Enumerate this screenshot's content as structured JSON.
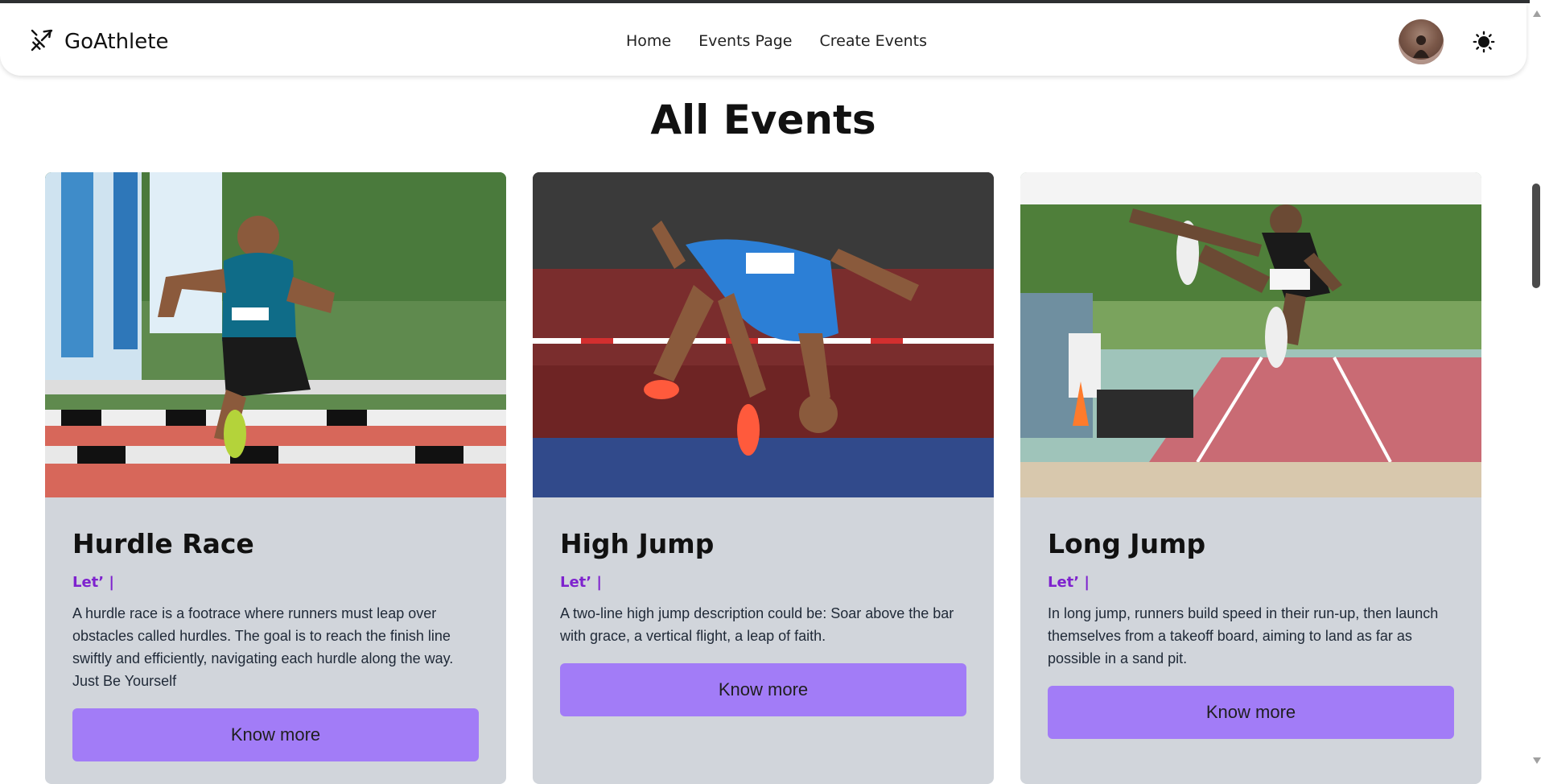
{
  "brand": {
    "name": "GoAthlete",
    "logo_icon": "plane-arrow-icon"
  },
  "nav": {
    "items": [
      {
        "label": "Home"
      },
      {
        "label": "Events Page"
      },
      {
        "label": "Create Events"
      }
    ]
  },
  "header": {
    "avatar_icon": "user-avatar",
    "theme_icon": "sun-icon"
  },
  "main": {
    "title": "All Events"
  },
  "events": [
    {
      "title": "Hurdle Race",
      "tag": "Let’ |",
      "description": "A hurdle race is a footrace where runners must leap over obstacles called hurdles. The goal is to reach the finish line swiftly and efficiently, navigating each hurdle along the way. Just Be Yourself",
      "button_label": "Know more",
      "image": "hurdle-athlete-photo"
    },
    {
      "title": "High Jump",
      "tag": "Let’ |",
      "description": "A two-line high jump description could be: Soar above the bar with grace, a vertical flight, a leap of faith.",
      "button_label": "Know more",
      "image": "high-jump-athlete-photo"
    },
    {
      "title": "Long Jump",
      "tag": "Let’ |",
      "description": "In long jump, runners build speed in their run-up, then launch themselves from a takeoff board, aiming to land as far as possible in a sand pit.",
      "button_label": "Know more",
      "image": "long-jump-athlete-photo"
    }
  ],
  "colors": {
    "accent": "#a27cf7",
    "tag": "#7e22ce",
    "card_bg": "#d1d5db"
  }
}
